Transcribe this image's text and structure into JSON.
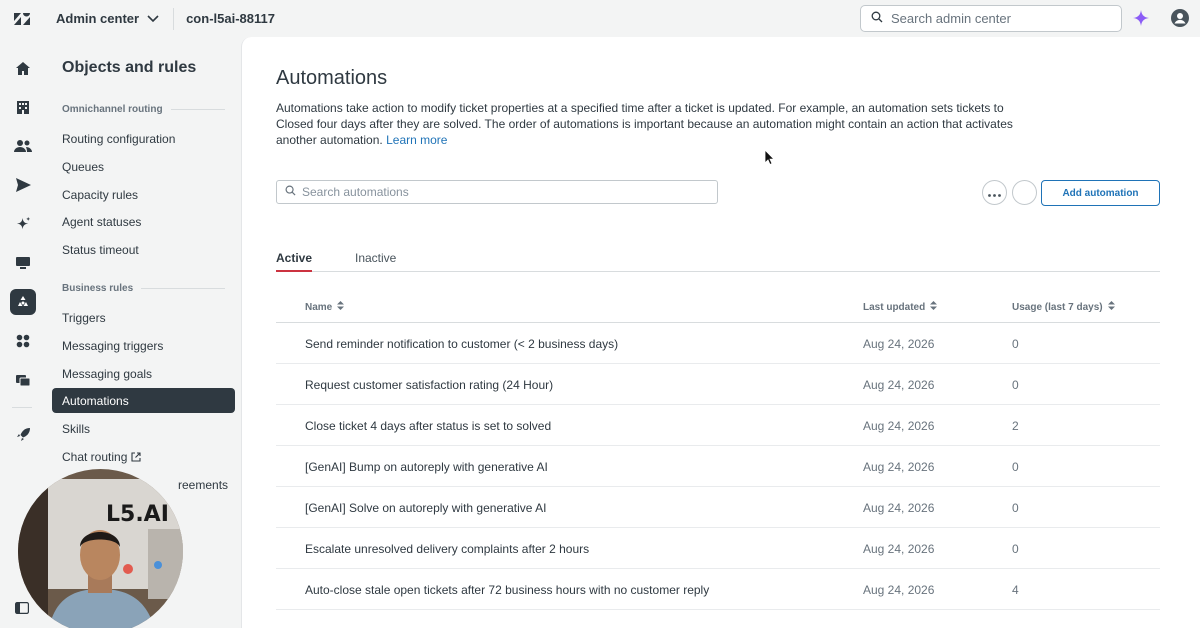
{
  "topbar": {
    "product": "Admin center",
    "account": "con-l5ai-88117",
    "search_placeholder": "Search admin center"
  },
  "rail": {
    "items": [
      "home-icon",
      "building-icon",
      "people-icon",
      "send-icon",
      "sparkle-icon",
      "monitor-icon",
      "objects-rules-icon",
      "apps-grid-icon",
      "workspaces-icon",
      "rocket-icon"
    ],
    "active": "objects-rules-icon"
  },
  "sidenav": {
    "title": "Objects and rules",
    "sections": [
      {
        "heading": "Omnichannel routing",
        "items": [
          "Routing configuration",
          "Queues",
          "Capacity rules",
          "Agent statuses",
          "Status timeout"
        ]
      },
      {
        "heading": "Business rules",
        "items": [
          "Triggers",
          "Messaging triggers",
          "Messaging goals",
          "Automations",
          "Skills",
          "Chat routing",
          "Service level agreements"
        ]
      }
    ],
    "partial_visible_label": "reements"
  },
  "main": {
    "title": "Automations",
    "description": "Automations take action to modify ticket properties at a specified time after a ticket is updated. For example, an automation sets tickets to Closed four days after they are solved. The order of automations is important because an automation might contain an action that activates another automation.",
    "learn_more": "Learn more",
    "search_placeholder": "Search automations",
    "add_button": "Add automation",
    "tabs": [
      "Active",
      "Inactive"
    ],
    "active_tab": "Active",
    "columns": [
      "Name",
      "Last updated",
      "Usage (last 7 days)"
    ],
    "rows": [
      {
        "name": "Send reminder notification to customer (< 2 business days)",
        "updated": "Aug 24, 2026",
        "usage": "0"
      },
      {
        "name": "Request customer satisfaction rating (24 Hour)",
        "updated": "Aug 24, 2026",
        "usage": "0"
      },
      {
        "name": "Close ticket 4 days after status is set to solved",
        "updated": "Aug 24, 2026",
        "usage": "2"
      },
      {
        "name": "[GenAI] Bump on autoreply with generative AI",
        "updated": "Aug 24, 2026",
        "usage": "0"
      },
      {
        "name": "[GenAI] Solve on autoreply with generative AI",
        "updated": "Aug 24, 2026",
        "usage": "0"
      },
      {
        "name": "Escalate unresolved delivery complaints after 2 hours",
        "updated": "Aug 24, 2026",
        "usage": "0"
      },
      {
        "name": "Auto-close stale open tickets after 72 business hours with no customer reply",
        "updated": "Aug 24, 2026",
        "usage": "4"
      }
    ]
  },
  "webcam": {
    "sign_text": "L5.AI"
  },
  "colors": {
    "accent": "#1f73b7",
    "tab_underline": "#cc3340",
    "selected_nav": "#2f3941",
    "ai_spark": "#8b5cf6"
  }
}
